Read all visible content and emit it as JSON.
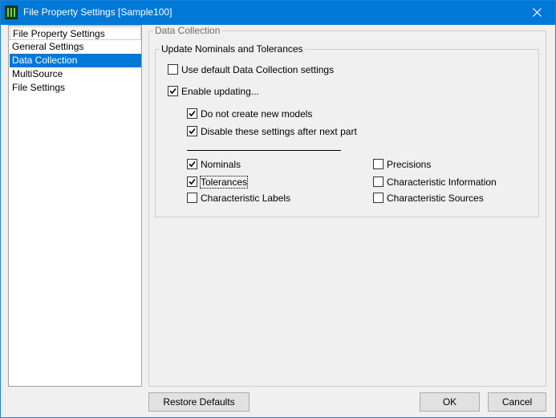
{
  "window": {
    "title": "File Property Settings [Sample100]",
    "close_glyph": "×"
  },
  "nav": {
    "items": [
      {
        "label": "File Property Settings"
      },
      {
        "label": "General Settings"
      },
      {
        "label": "Data Collection"
      },
      {
        "label": "MultiSource"
      },
      {
        "label": "File Settings"
      }
    ],
    "selected": "Data Collection"
  },
  "panel": {
    "group_title": "Data Collection",
    "update_group_title": "Update Nominals and Tolerances",
    "options": {
      "use_default": {
        "label": "Use default Data Collection settings",
        "checked": false
      },
      "enable_updating": {
        "label": "Enable updating...",
        "checked": true
      },
      "no_new_models": {
        "label": "Do not create new models",
        "checked": true
      },
      "disable_after_next": {
        "label": "Disable these settings after next part",
        "checked": true
      }
    },
    "fields": {
      "nominals": {
        "label": "Nominals",
        "checked": true
      },
      "tolerances": {
        "label": "Tolerances",
        "checked": true
      },
      "char_labels": {
        "label": "Characteristic Labels",
        "checked": false
      },
      "precisions": {
        "label": "Precisions",
        "checked": false
      },
      "char_info": {
        "label": "Characteristic Information",
        "checked": false
      },
      "char_sources": {
        "label": "Characteristic Sources",
        "checked": false
      }
    }
  },
  "buttons": {
    "restore_defaults": "Restore Defaults",
    "ok": "OK",
    "cancel": "Cancel"
  },
  "colors": {
    "titlebar": "#0078d7",
    "selection": "#0078d7",
    "window_bg": "#f0f0f0"
  }
}
